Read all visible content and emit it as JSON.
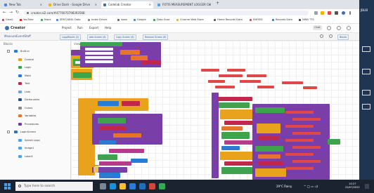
{
  "browser": {
    "tabs": [
      {
        "label": "New Tab",
        "color": "#4285f4",
        "active": false
      },
      {
        "label": "Drive Dash - Google Drive",
        "color": "#f4b400",
        "active": false
      },
      {
        "label": "Codelab Creator",
        "color": "#3a6fb0",
        "active": true
      },
      {
        "label": "FOTIS MEASUREMENT LOGGER CH",
        "color": "#4aa3ef",
        "active": false
      }
    ],
    "new_tab_symbol": "+",
    "url": "creator.ai2.com/#4770070798393568",
    "bookmarks": [
      {
        "label": "Gmail",
        "color": "#d44638"
      },
      {
        "label": "YouTube",
        "color": "#ff0000"
      },
      {
        "label": "Maps",
        "color": "#34a853"
      },
      {
        "label": "SENT/ABEL Data",
        "color": "#4285f4"
      },
      {
        "label": "Index Drives",
        "color": "#888888"
      },
      {
        "label": "www",
        "color": "#666666"
      },
      {
        "label": "Google",
        "color": "#4285f4"
      },
      {
        "label": "Data Ecoe",
        "color": "#34a853"
      },
      {
        "label": "Chrome Web Store",
        "color": "#f4b400"
      },
      {
        "label": "Home Records Data",
        "color": "#555555"
      },
      {
        "label": "ENFSEE",
        "color": "#e04848"
      },
      {
        "label": "Records Data",
        "color": "#2a7bd6"
      },
      {
        "label": "NWN TTS",
        "color": "#444444"
      }
    ]
  },
  "app": {
    "name": "Creator",
    "menus": [
      "Project",
      "Run",
      "Export",
      "Help"
    ],
    "header_buttons": [
      "Chat",
      "Data"
    ],
    "project_name": "MeasureEventStaff",
    "toolbar_buttons": [
      "Logs/Blocks (2)",
      "Add Screen (8)",
      "Copy Screen (8)",
      "Remove Screen (8)"
    ],
    "designer_label": "Designer",
    "blocks_label": "Blocks"
  },
  "sidebar": {
    "header": "Blocks",
    "items": [
      {
        "label": "Built-in",
        "color": "#2a7bd6",
        "toggle": true
      },
      {
        "label": "Control",
        "color": "#e8a21c",
        "toggle": false
      },
      {
        "label": "Logic",
        "color": "#3fa34d",
        "toggle": false
      },
      {
        "label": "Math",
        "color": "#2a7bd6",
        "toggle": false
      },
      {
        "label": "Text",
        "color": "#c1264b",
        "toggle": false
      },
      {
        "label": "Lists",
        "color": "#6fa4d6",
        "toggle": false
      },
      {
        "label": "Dictionaries",
        "color": "#2d4d86",
        "toggle": false
      },
      {
        "label": "Colors",
        "color": "#888888",
        "toggle": false
      },
      {
        "label": "Variables",
        "color": "#e8742c",
        "toggle": false
      },
      {
        "label": "Procedures",
        "color": "#6f3b9a",
        "toggle": false
      },
      {
        "label": "LoginScreen",
        "color": "#3a6fb0",
        "toggle": true
      },
      {
        "label": "Splash Logo",
        "color": "#4aa3ef",
        "toggle": false
      },
      {
        "label": "Image1",
        "color": "#4aa3ef",
        "toggle": false
      },
      {
        "label": "Label1",
        "color": "#4aa3ef",
        "toggle": false
      }
    ]
  },
  "workspace": {
    "label": "Viewer"
  },
  "desktop": {
    "label": "JBLIB"
  },
  "taskbar": {
    "search_placeholder": "Type here to search",
    "apps": [
      {
        "name": "task-view",
        "color": "#7a8596"
      },
      {
        "name": "edge",
        "color": "#1d8fd8"
      },
      {
        "name": "explorer",
        "color": "#f3c13a"
      },
      {
        "name": "store",
        "color": "#2a7bd6"
      },
      {
        "name": "mail",
        "color": "#1f6fbf"
      },
      {
        "name": "app",
        "color": "#d44638"
      },
      {
        "name": "chrome",
        "color": "#34a853"
      }
    ],
    "weather": "29°C Rainy",
    "time": "10:27",
    "date": "23/07/2022"
  },
  "blocks_palette": {
    "control": "#e8a21c",
    "purple": "#7a3ea8",
    "green": "#3fa34d",
    "blue": "#2a7bd6",
    "pink": "#c1264b",
    "orange": "#e8742c",
    "text": "#b83a8a"
  }
}
